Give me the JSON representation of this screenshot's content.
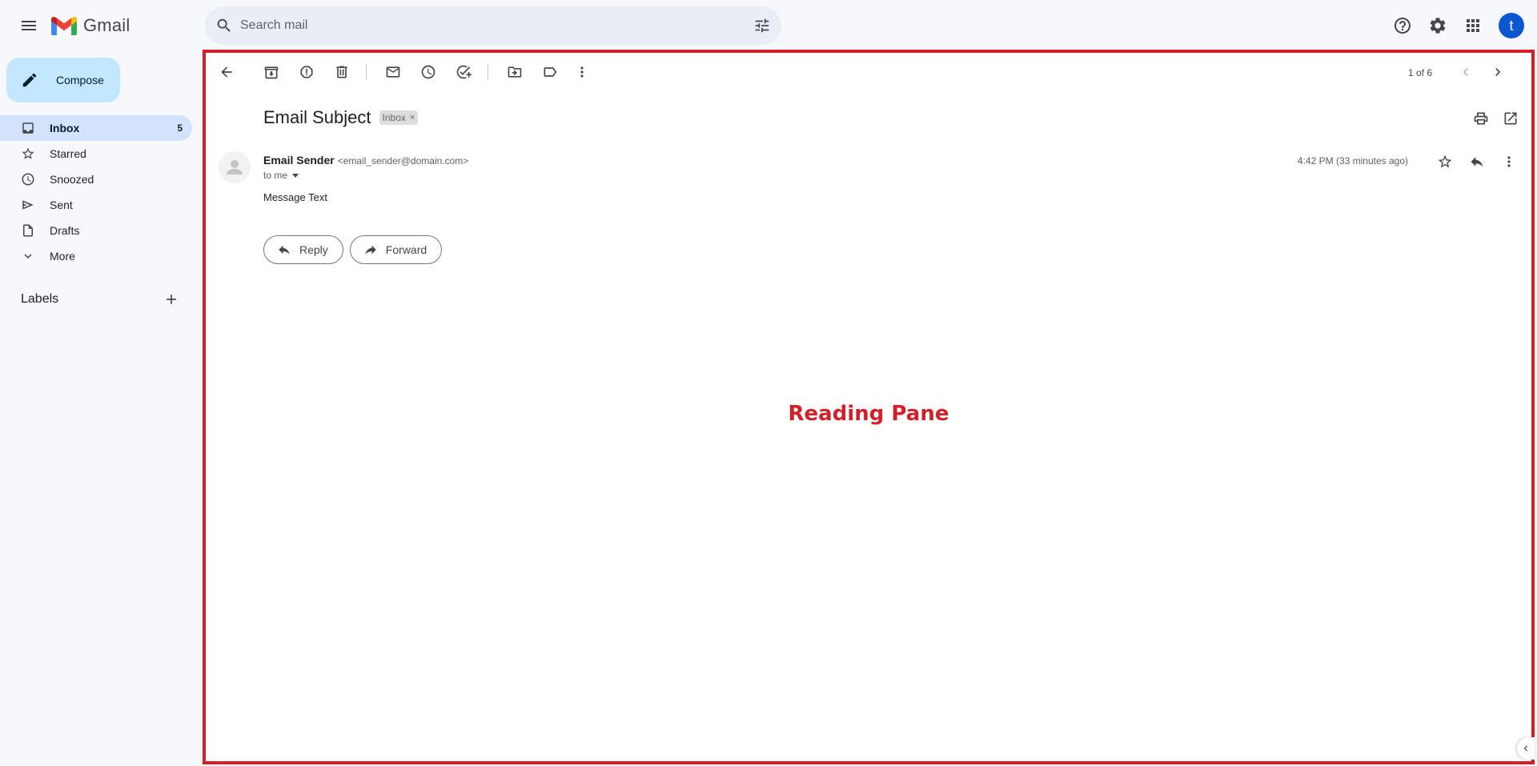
{
  "app": {
    "name": "Gmail"
  },
  "search": {
    "placeholder": "Search mail"
  },
  "header": {
    "avatar_letter": "t",
    "icons": [
      "menu-icon",
      "search-icon",
      "filter-options-icon",
      "help-icon",
      "settings-icon",
      "apps-icon"
    ]
  },
  "sidebar": {
    "compose_label": "Compose",
    "items": [
      {
        "label": "Inbox",
        "count": "5",
        "icon": "inbox-icon",
        "active": true
      },
      {
        "label": "Starred",
        "count": "",
        "icon": "star-icon"
      },
      {
        "label": "Snoozed",
        "count": "",
        "icon": "clock-icon"
      },
      {
        "label": "Sent",
        "count": "",
        "icon": "send-icon"
      },
      {
        "label": "Drafts",
        "count": "",
        "icon": "draft-icon"
      },
      {
        "label": "More",
        "count": "",
        "icon": "chevron-down-icon"
      }
    ],
    "labels_heading": "Labels"
  },
  "toolbar": {
    "pager": "1 of 6"
  },
  "email": {
    "subject": "Email Subject",
    "label_chip": "Inbox",
    "sender_name": "Email Sender",
    "sender_email": "<email_sender@domain.com>",
    "recipient": "to me",
    "time": "4:42 PM (33 minutes ago)",
    "body": "Message Text",
    "reply_label": "Reply",
    "forward_label": "Forward"
  },
  "annotation": {
    "label": "Reading Pane",
    "color": "#d32028"
  },
  "colors": {
    "background": "#f6f8fc",
    "compose": "#c2e7ff",
    "active_nav": "#d3e3fd",
    "avatar": "#0b57d0"
  }
}
